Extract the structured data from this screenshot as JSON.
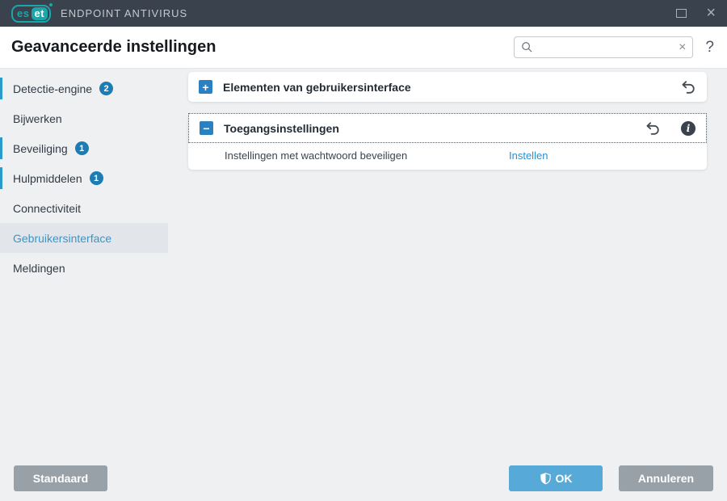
{
  "titlebar": {
    "logo": {
      "left": "es",
      "right": "et"
    },
    "app_name": "ENDPOINT ANTIVIRUS"
  },
  "header": {
    "title": "Geavanceerde instellingen",
    "search_value": "",
    "search_placeholder": "",
    "help_label": "?"
  },
  "icons": {
    "close": "×",
    "search_clear": "×",
    "info": "i",
    "expand": "+",
    "collapse": "−"
  },
  "sidebar": {
    "items": [
      {
        "label": "Detectie-engine",
        "badge": "2",
        "flagged": true
      },
      {
        "label": "Bijwerken"
      },
      {
        "label": "Beveiliging",
        "badge": "1",
        "flagged": true
      },
      {
        "label": "Hulpmiddelen",
        "badge": "1",
        "flagged": true
      },
      {
        "label": "Connectiviteit"
      },
      {
        "label": "Gebruikersinterface",
        "selected": true
      },
      {
        "label": "Meldingen"
      }
    ]
  },
  "sections": [
    {
      "title": "Elementen van gebruikersinterface",
      "state": "collapsed"
    },
    {
      "title": "Toegangsinstellingen",
      "state": "expanded",
      "rows": [
        {
          "label": "Instellingen met wachtwoord beveiligen",
          "action": "Instellen"
        }
      ]
    }
  ],
  "footer": {
    "default": "Standaard",
    "ok": "OK",
    "cancel": "Annuleren"
  },
  "colors": {
    "titlebar_bg": "#3a424d",
    "eset_teal": "#1aa7ab",
    "accent_blue": "#2b80c2",
    "badge_blue": "#1d7cb4",
    "selected_link_blue": "#3b96c8",
    "link_blue": "#2e8fcd",
    "ok_button_blue": "#57a9d8",
    "gray_button": "#99a1a8",
    "content_bg": "#eef0f2"
  }
}
